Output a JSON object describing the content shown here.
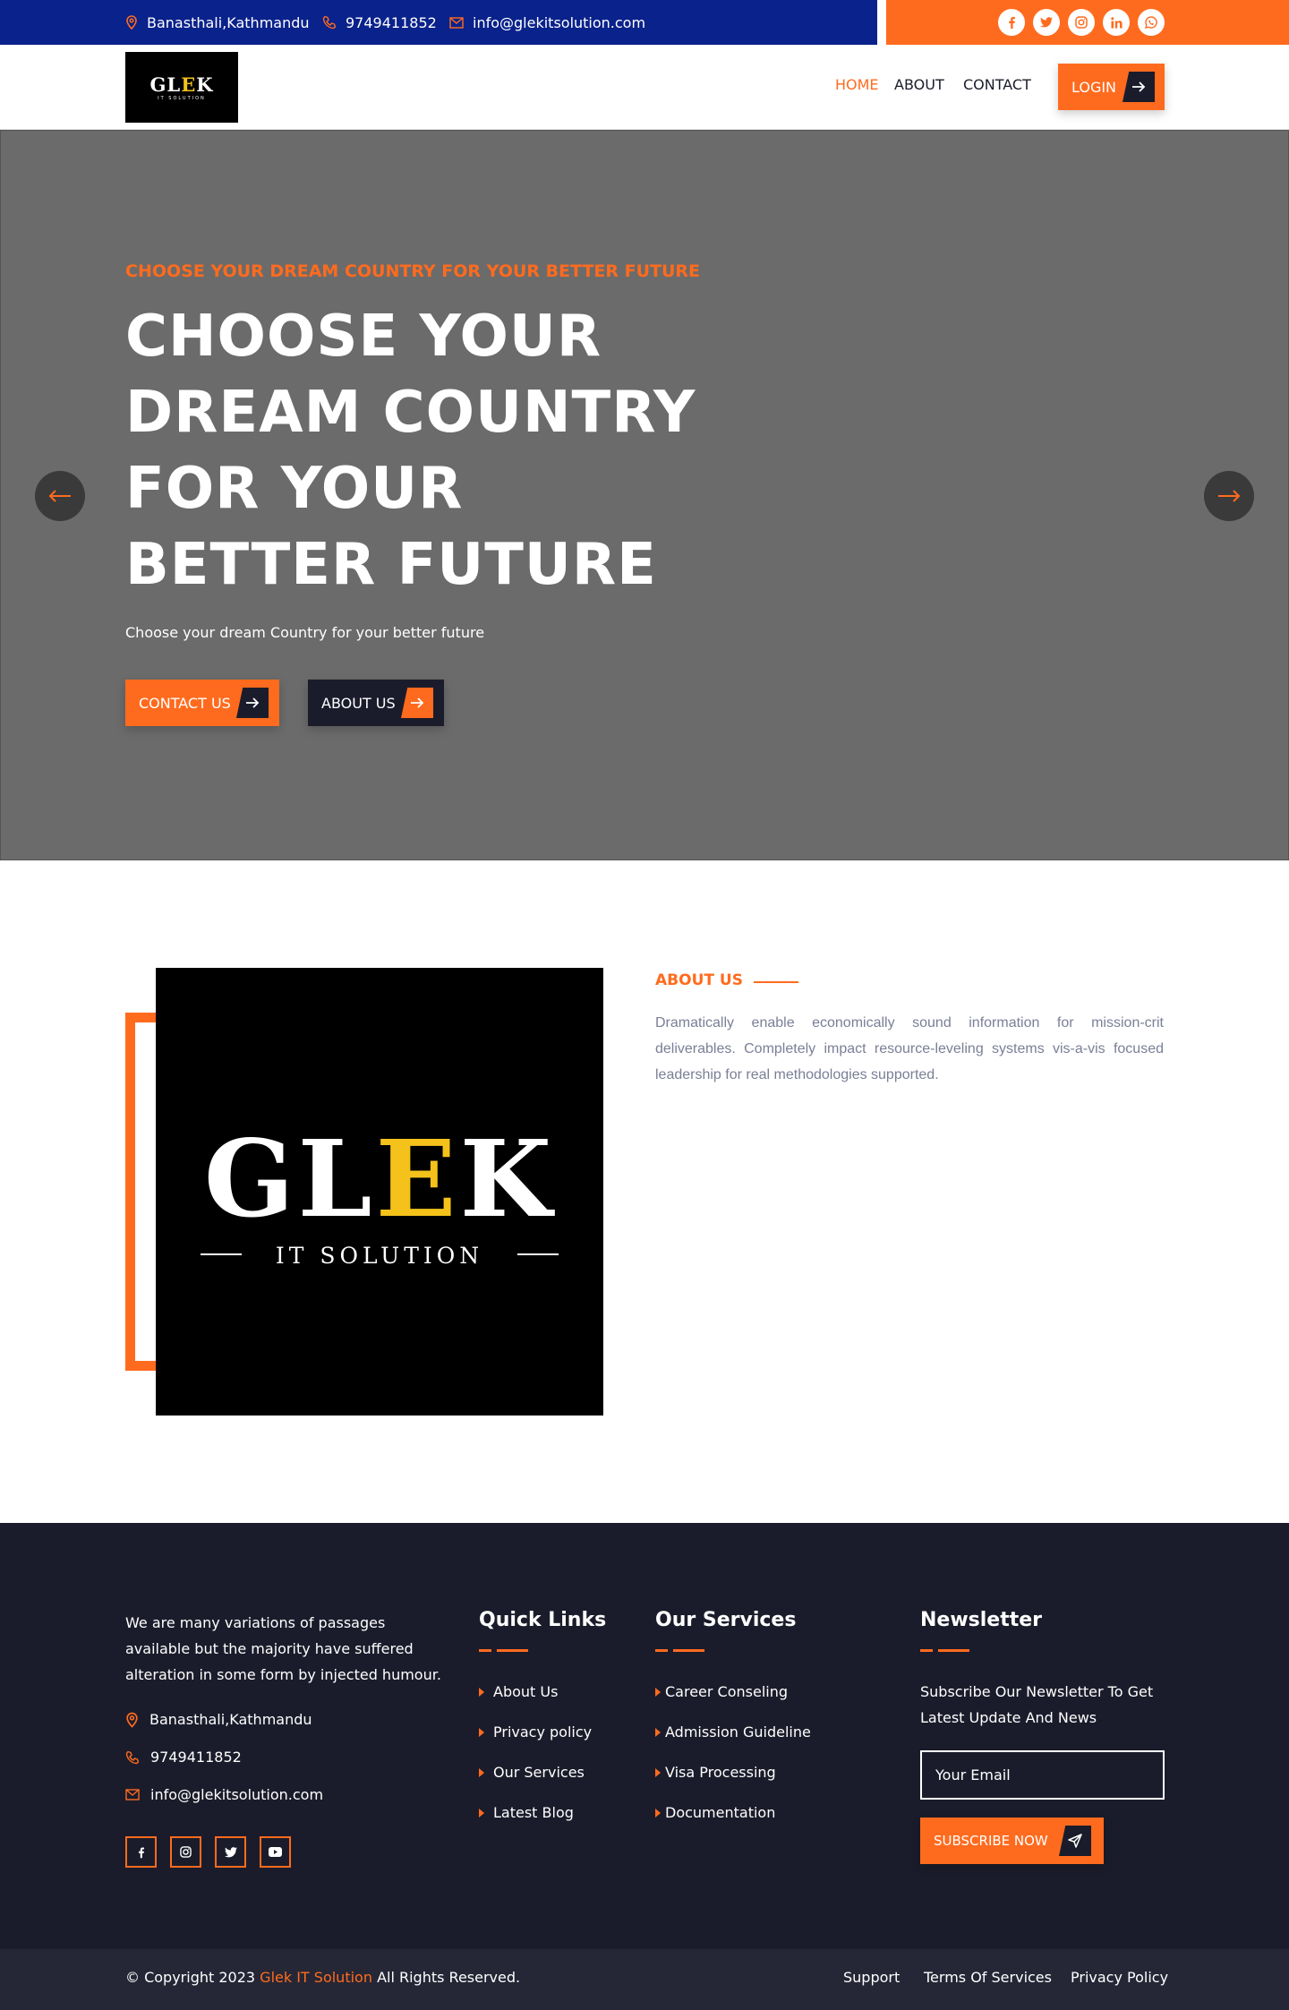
{
  "topbar": {
    "address": "Banasthali,Kathmandu",
    "phone": "9749411852",
    "email": "info@glekitsolution.com",
    "social": [
      "facebook-icon",
      "twitter-icon",
      "instagram-icon",
      "linkedin-icon",
      "whatsapp-icon"
    ]
  },
  "nav": {
    "logo_main_1": "GL",
    "logo_main_e": "E",
    "logo_main_2": "K",
    "logo_sub": "IT SOLUTION",
    "items": [
      "HOME",
      "ABOUT",
      "CONTACT"
    ],
    "login_label": "LOGIN"
  },
  "hero": {
    "subtitle": "CHOOSE YOUR DREAM COUNTRY FOR YOUR BETTER FUTURE",
    "title": "CHOOSE YOUR DREAM COUNTRY FOR YOUR BETTER FUTURE",
    "description": "Choose your dream Country for your better future",
    "contact_button": "CONTACT US",
    "about_button": "ABOUT US"
  },
  "about": {
    "tag": "ABOUT US",
    "text": "Dramatically enable economically sound information for mission-crit deliverables. Completely impact resource-leveling systems vis-a-vis focused leadership for real methodologies supported.",
    "logo_main_1": "GL",
    "logo_main_e": "E",
    "logo_main_2": "K",
    "logo_sub": "IT SOLUTION"
  },
  "footer": {
    "intro": "We are many variations of passages available but the majority have suffered alteration in some form by injected humour.",
    "address": "Banasthali,Kathmandu",
    "phone": "9749411852",
    "email": "info@glekitsolution.com",
    "social": [
      "facebook-icon",
      "instagram-icon",
      "twitter-icon",
      "youtube-icon"
    ],
    "quick_links": {
      "title": "Quick Links",
      "items": [
        "About Us",
        "Privacy policy",
        "Our Services",
        "Latest Blog"
      ]
    },
    "services": {
      "title": "Our Services",
      "items": [
        "Career Conseling",
        "Admission Guideline",
        "Visa Processing",
        "Documentation"
      ]
    },
    "newsletter": {
      "title": "Newsletter",
      "text": "Subscribe Our Newsletter To Get Latest Update And News",
      "placeholder": "Your Email",
      "button": "SUBSCRIBE NOW"
    }
  },
  "bottom": {
    "copyright_prefix": "© Copyright 2023",
    "company": "Glek IT Solution",
    "copyright_suffix": "All Rights Reserved.",
    "links": [
      "Support",
      "Terms Of Services",
      "Privacy Policy"
    ]
  },
  "colors": {
    "primary": "#ff6b1e",
    "topbar_blue": "#0a228b",
    "dark": "#1b1c2b",
    "hero_gray": "#6b6b6b",
    "logo_yellow": "#f4c21b"
  }
}
